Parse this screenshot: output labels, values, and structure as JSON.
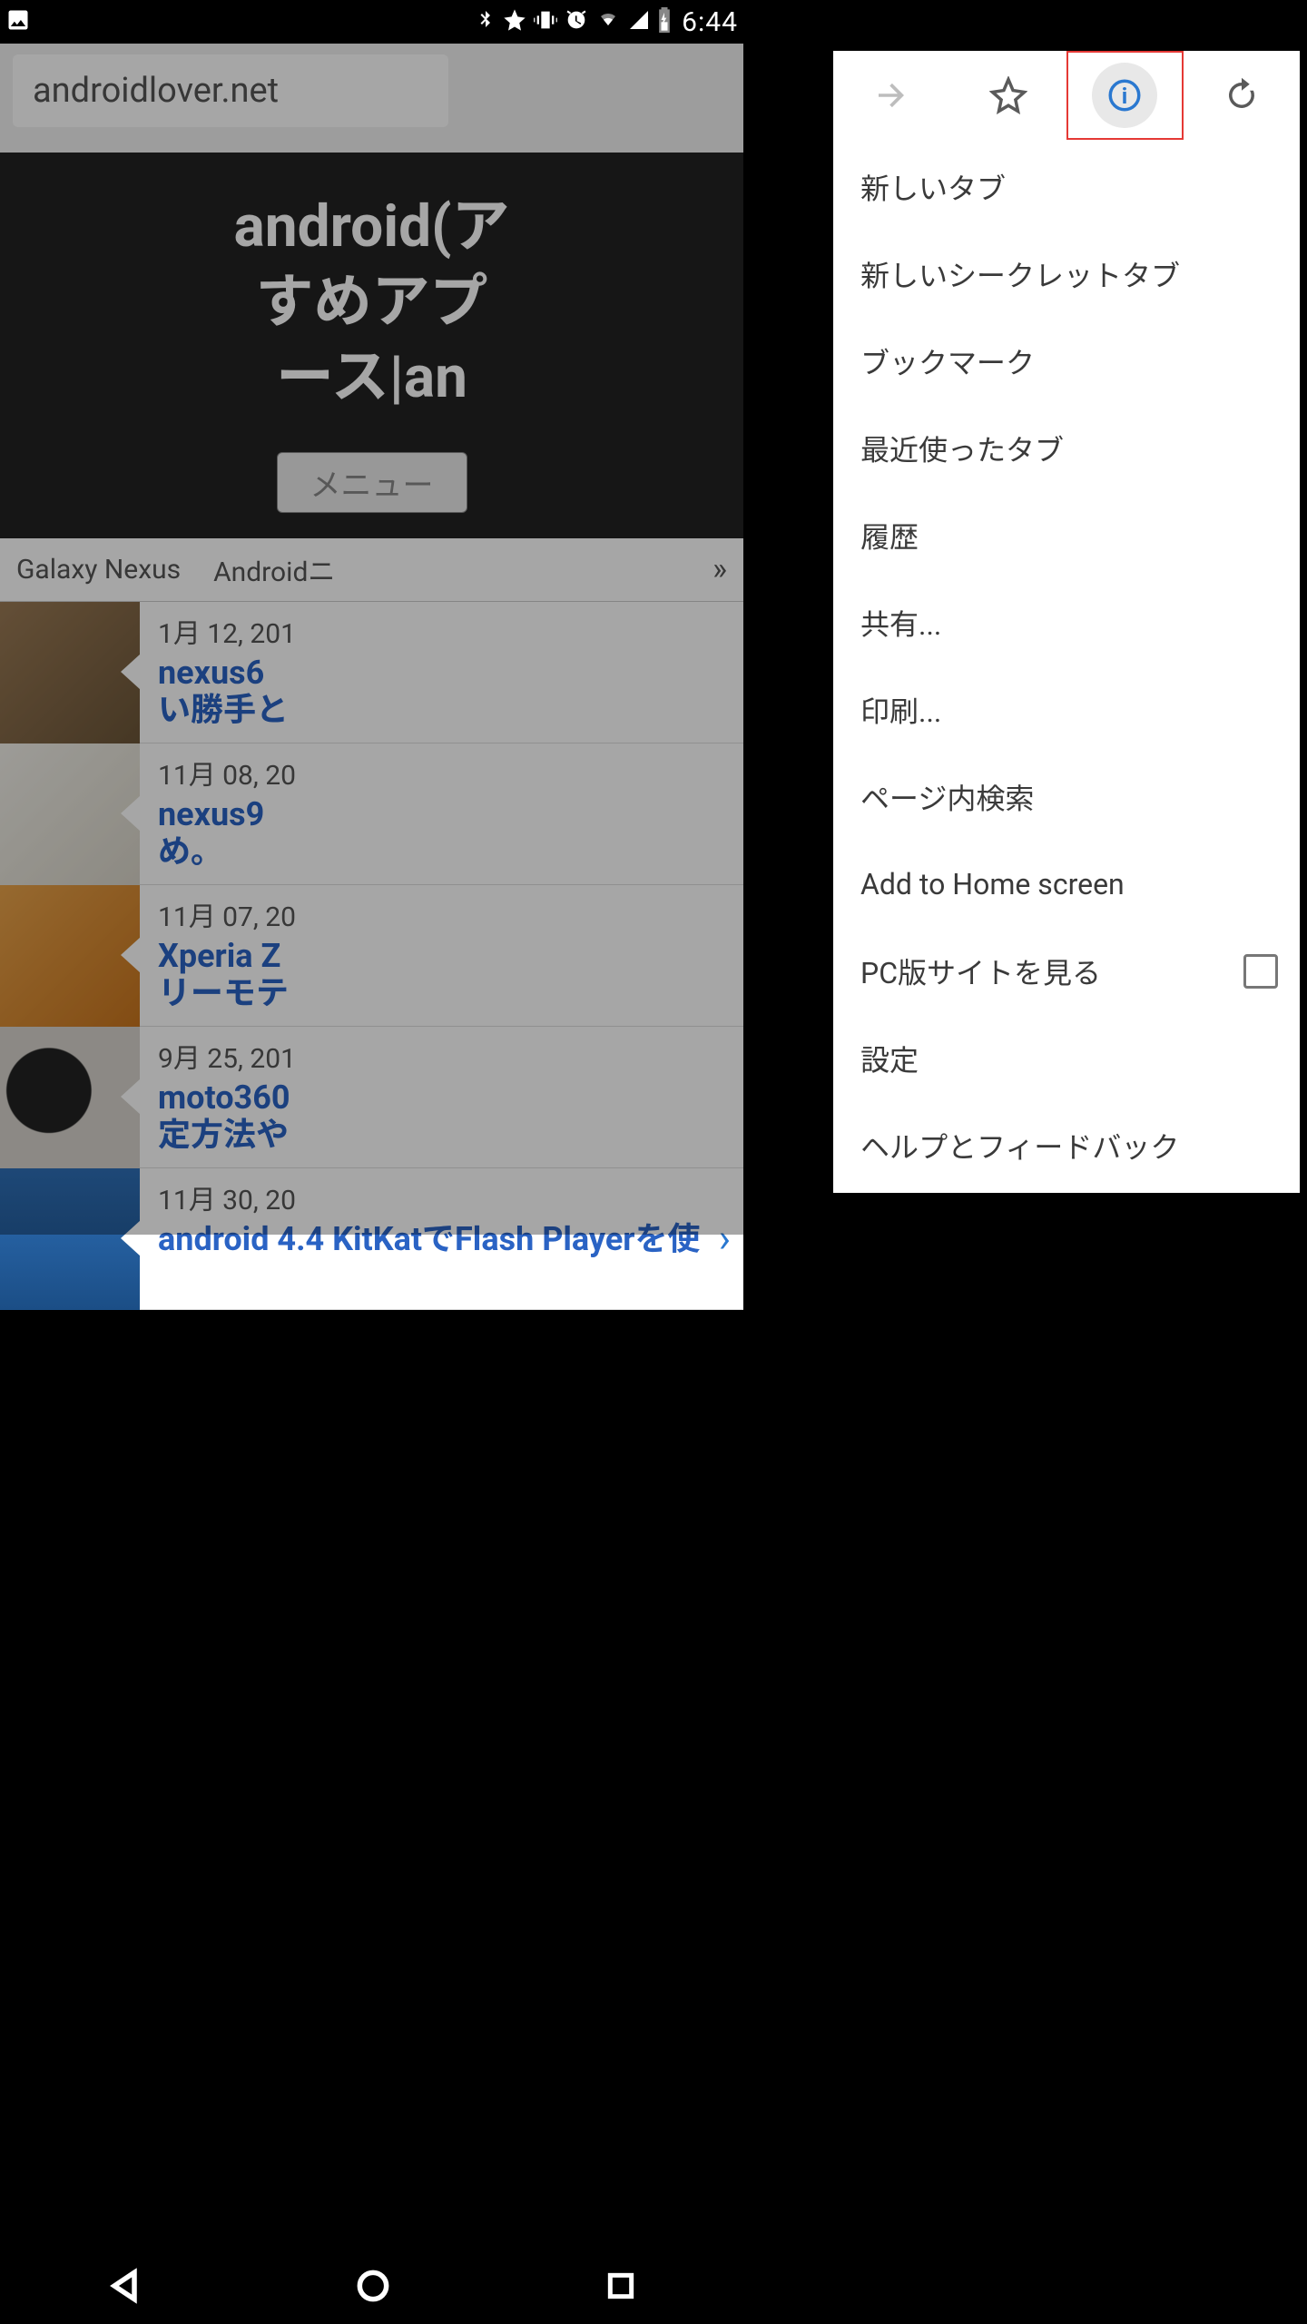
{
  "status": {
    "time": "6:44"
  },
  "omnibox": {
    "url": "androidlover.net"
  },
  "page": {
    "title_lines": [
      "android(ア",
      "すめアプ",
      "ース|an"
    ],
    "menu_button": "メニュー",
    "tabs": [
      "Galaxy Nexus",
      "Androidニ"
    ],
    "posts": [
      {
        "date": "1月 12, 201",
        "title": "nexus6\nい勝手と"
      },
      {
        "date": "11月 08, 20",
        "title": "nexus9\nめ。"
      },
      {
        "date": "11月 07, 20",
        "title": "Xperia Z\nリーモテ"
      },
      {
        "date": "9月 25, 201",
        "title": "moto360\n定方法や"
      },
      {
        "date": "11月 30, 20",
        "title": "android 4.4 KitKatでFlash Playerを使"
      }
    ]
  },
  "menu": {
    "icons": {
      "forward": "forward",
      "star": "star",
      "info": "info",
      "reload": "reload"
    },
    "items": [
      "新しいタブ",
      "新しいシークレットタブ",
      "ブックマーク",
      "最近使ったタブ",
      "履歴",
      "共有...",
      "印刷...",
      "ページ内検索",
      "Add to Home screen",
      "PC版サイトを見る",
      "設定",
      "ヘルプとフィードバック"
    ],
    "checkbox_index": 9
  }
}
